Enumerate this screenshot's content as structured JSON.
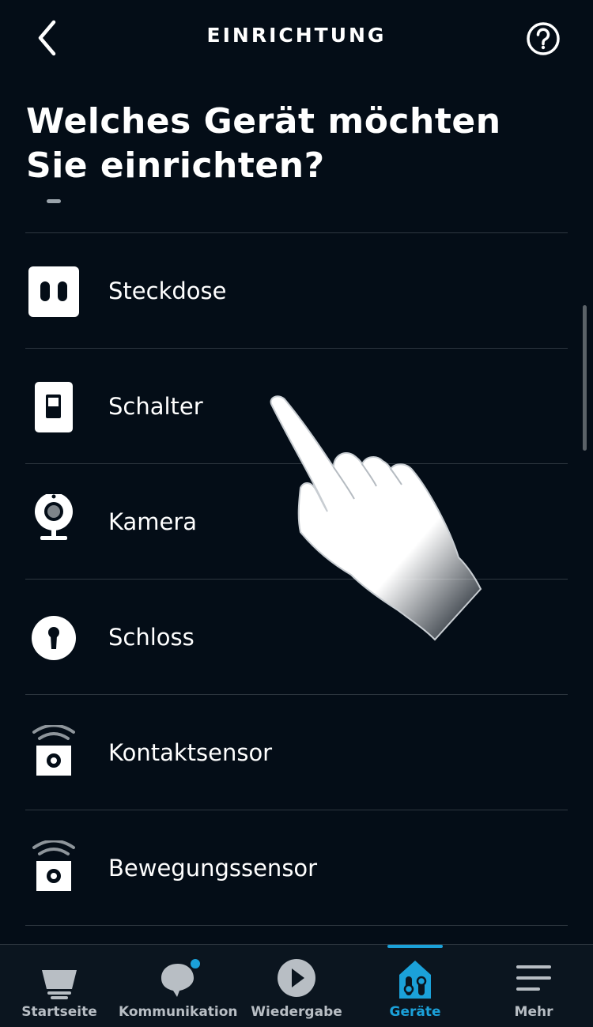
{
  "header": {
    "title": "EINRICHTUNG",
    "back_icon": "chevron-left-icon",
    "help_icon": "help-icon"
  },
  "page": {
    "title": "Welches Gerät möchten Sie einrichten?"
  },
  "devices": [
    {
      "label": "Steckdose",
      "icon": "plug-icon"
    },
    {
      "label": "Schalter",
      "icon": "switch-icon"
    },
    {
      "label": "Kamera",
      "icon": "camera-icon"
    },
    {
      "label": "Schloss",
      "icon": "lock-icon"
    },
    {
      "label": "Kontaktsensor",
      "icon": "contact-sensor-icon"
    },
    {
      "label": "Bewegungssensor",
      "icon": "motion-sensor-icon"
    }
  ],
  "tabs": [
    {
      "label": "Startseite",
      "icon": "home-icon",
      "active": false
    },
    {
      "label": "Kommunikation",
      "icon": "chat-icon",
      "active": false,
      "notification": true
    },
    {
      "label": "Wiedergabe",
      "icon": "play-icon",
      "active": false
    },
    {
      "label": "Geräte",
      "icon": "devices-icon",
      "active": true
    },
    {
      "label": "Mehr",
      "icon": "menu-icon",
      "active": false
    }
  ],
  "colors": {
    "background": "#040d17",
    "accent": "#1ba1d9",
    "divider": "#2e3740",
    "tab_label": "#b8bec4"
  }
}
